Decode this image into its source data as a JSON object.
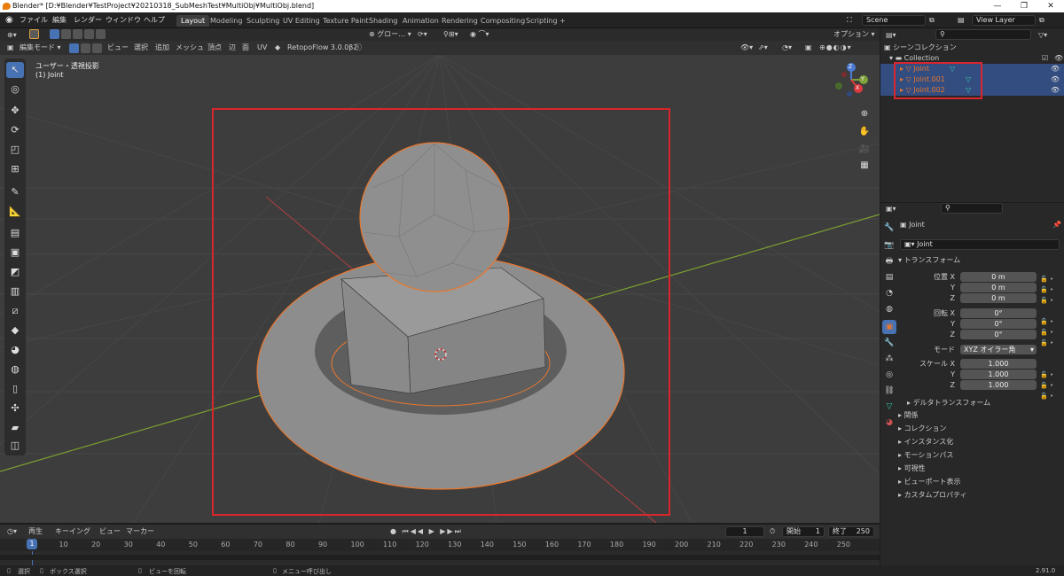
{
  "title": "Blender* [D:¥Blender¥TestProject¥20210318_SubMeshTest¥MultiObj¥MultiObj.blend]",
  "main_menu": [
    "ファイル",
    "編集",
    "レンダー",
    "ウィンドウ",
    "ヘルプ"
  ],
  "workspaces": [
    "Layout",
    "Modeling",
    "Sculpting",
    "UV Editing",
    "Texture Paint",
    "Shading",
    "Animation",
    "Rendering",
    "Compositing",
    "Scripting",
    "+"
  ],
  "scene": "Scene",
  "view_layer": "View Layer",
  "header3d": {
    "transform": "グロー…",
    "options": "オプション"
  },
  "header3d_menu": {
    "mode": "編集モード",
    "items": [
      "ビュー",
      "選択",
      "追加",
      "メッシュ",
      "頂点",
      "辺",
      "面",
      "UV"
    ],
    "addon": "RetopoFlow 3.0.0β2"
  },
  "viewport": {
    "view_name": "ユーザー・透視投影",
    "object_info": "(1) Joint"
  },
  "gizmo": {
    "x": "X",
    "y": "Y",
    "z": "Z"
  },
  "outliner": {
    "scene_collection": "シーンコレクション",
    "collection": "Collection",
    "objects": [
      "Joint",
      "Joint.001",
      "Joint.002"
    ]
  },
  "props": {
    "object_name": "Joint",
    "data_name": "Joint",
    "transform_label": "トランスフォーム",
    "location_label": "位置 X",
    "rotation_label": "回転 X",
    "scale_label": "スケール X",
    "y": "Y",
    "z": "Z",
    "location": [
      "0 m",
      "0 m",
      "0 m"
    ],
    "rotation": [
      "0°",
      "0°",
      "0°"
    ],
    "mode_label": "モード",
    "mode_value": "XYZ オイラー角",
    "scale": [
      "1.000",
      "1.000",
      "1.000"
    ],
    "delta": "デルタトランスフォーム",
    "panels": [
      "関係",
      "コレクション",
      "インスタンス化",
      "モーションパス",
      "可視性",
      "ビューポート表示",
      "カスタムプロパティ"
    ]
  },
  "timeline": {
    "menus": [
      "再生",
      "キーイング",
      "ビュー",
      "マーカー"
    ],
    "current_frame": "1",
    "start_label": "開始",
    "start": "1",
    "end_label": "終了",
    "end": "250",
    "ticks": [
      "10",
      "20",
      "30",
      "40",
      "50",
      "60",
      "70",
      "80",
      "90",
      "100",
      "110",
      "120",
      "130",
      "140",
      "150",
      "160",
      "170",
      "180",
      "190",
      "200",
      "210",
      "220",
      "230",
      "240",
      "250"
    ],
    "cursor": "1"
  },
  "status": {
    "select": "選択",
    "box_select": "ボックス選択",
    "rotate": "ビューを回転",
    "menu": "メニュー呼び出し",
    "version": "2.91.0"
  },
  "colors": {
    "accent": "#4772b3",
    "selection_box": "#d9262c",
    "object_orange": "#e8772e"
  }
}
